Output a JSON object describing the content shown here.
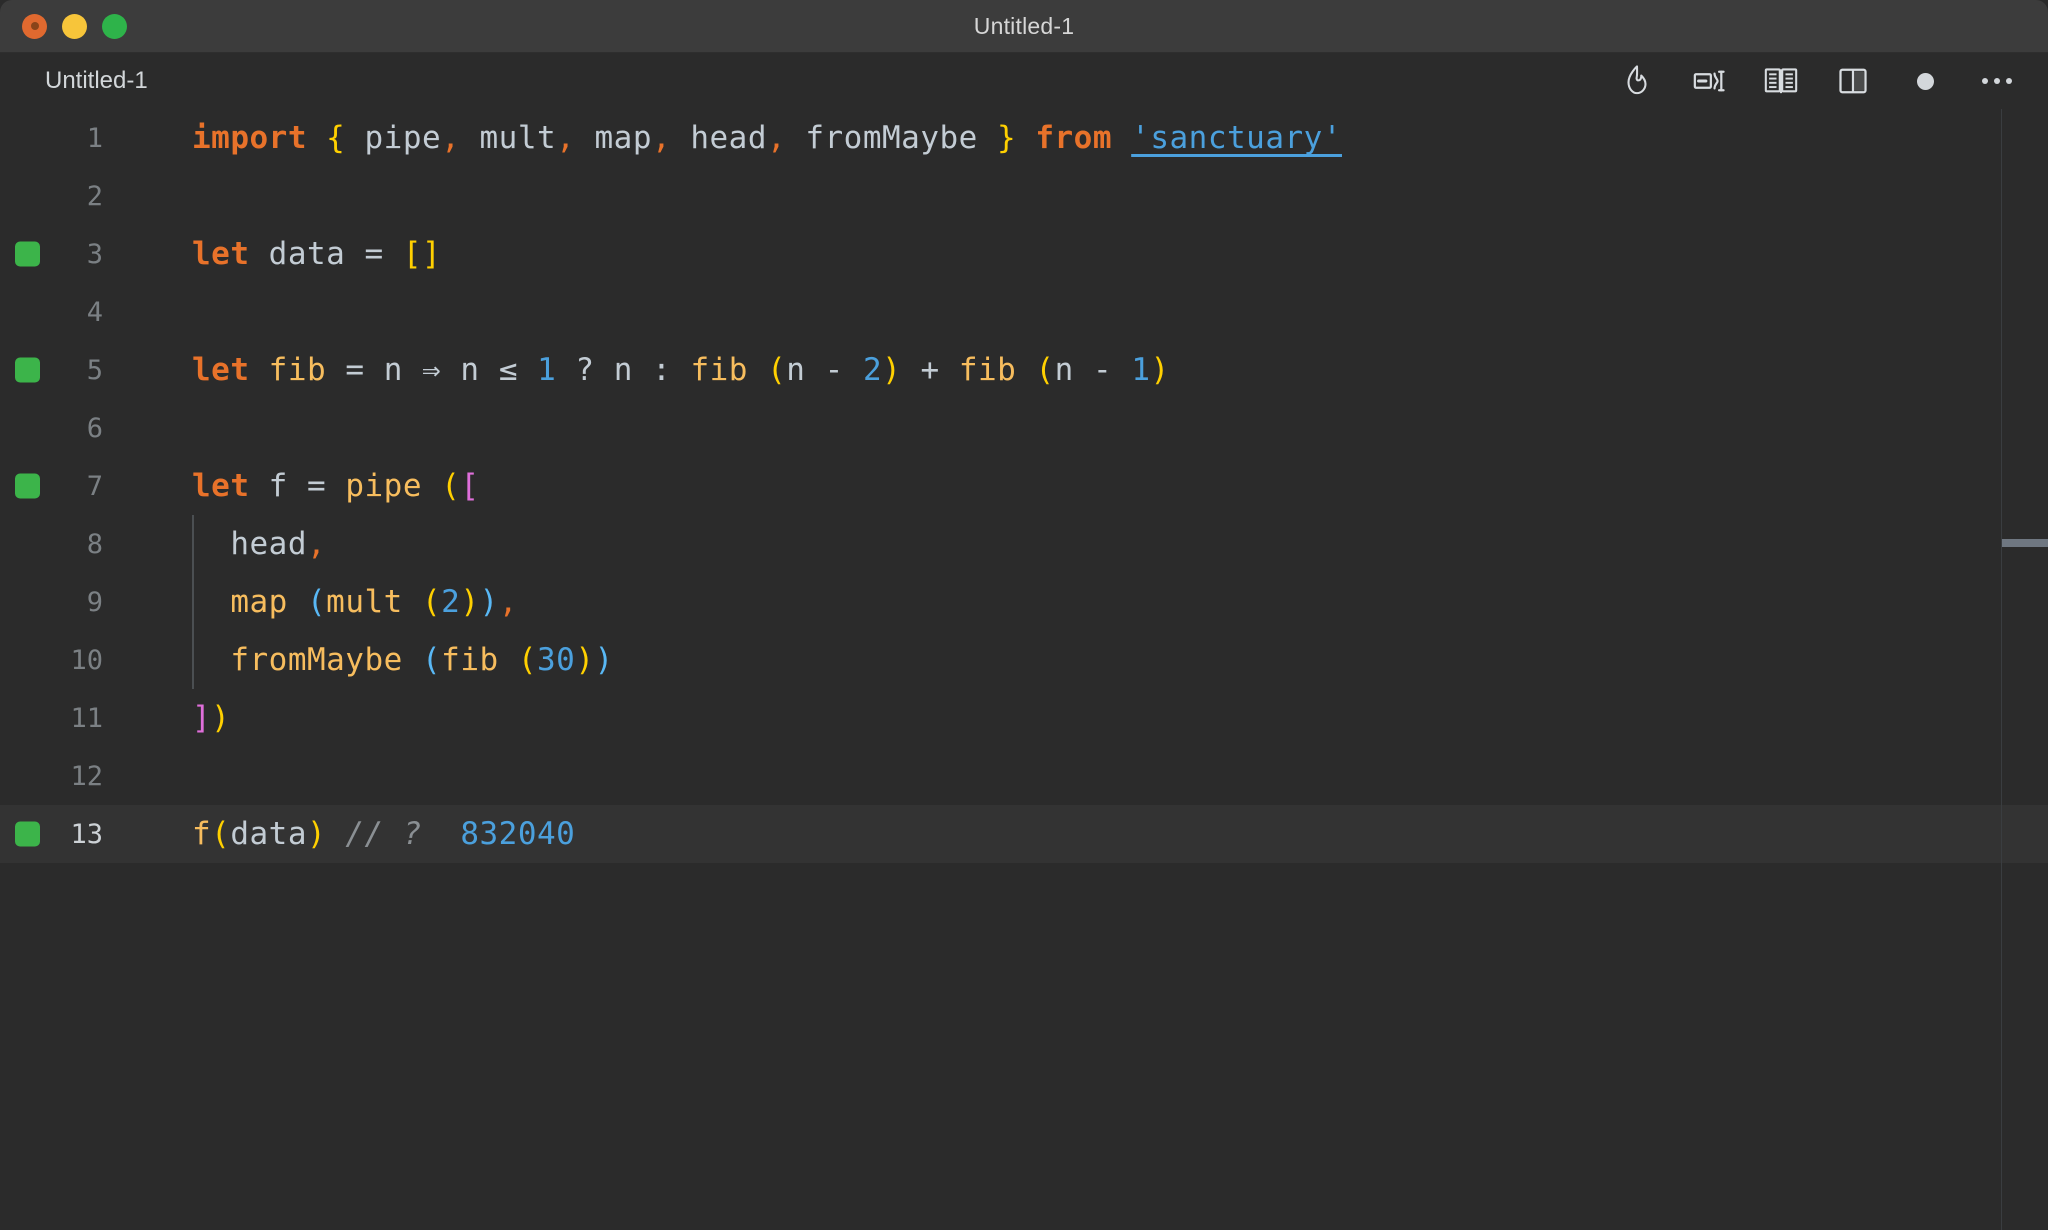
{
  "window": {
    "title": "Untitled-1",
    "traffic_lights": [
      "close-button",
      "minimize-button",
      "maximize-button"
    ]
  },
  "tabbar": {
    "tab_label": "Untitled-1",
    "toolbar_icons": [
      {
        "name": "flame-icon",
        "label": "Run Quokka"
      },
      {
        "name": "run-code-icon",
        "label": "Run Code"
      },
      {
        "name": "open-book-icon",
        "label": "Open Preview"
      },
      {
        "name": "split-editor-icon",
        "label": "Split Editor"
      },
      {
        "name": "record-dot-icon",
        "label": "Recording Indicator"
      },
      {
        "name": "more-actions-icon",
        "label": "More Actions"
      }
    ]
  },
  "editor": {
    "active_line": 13,
    "breakpoint_lines": [
      3,
      5,
      7,
      13
    ],
    "indent_guide_lines": [
      8,
      9,
      10
    ],
    "lines": [
      {
        "n": "1",
        "tokens": [
          {
            "t": "import",
            "c": "kw"
          },
          {
            "t": " ",
            "c": "op"
          },
          {
            "t": "{",
            "c": "br1"
          },
          {
            "t": " ",
            "c": "op"
          },
          {
            "t": "pipe",
            "c": "var"
          },
          {
            "t": ",",
            "c": "punc"
          },
          {
            "t": " ",
            "c": "op"
          },
          {
            "t": "mult",
            "c": "var"
          },
          {
            "t": ",",
            "c": "punc"
          },
          {
            "t": " ",
            "c": "op"
          },
          {
            "t": "map",
            "c": "var"
          },
          {
            "t": ",",
            "c": "punc"
          },
          {
            "t": " ",
            "c": "op"
          },
          {
            "t": "head",
            "c": "var"
          },
          {
            "t": ",",
            "c": "punc"
          },
          {
            "t": " ",
            "c": "op"
          },
          {
            "t": "fromMaybe",
            "c": "var"
          },
          {
            "t": " ",
            "c": "op"
          },
          {
            "t": "}",
            "c": "br1"
          },
          {
            "t": " ",
            "c": "op"
          },
          {
            "t": "from",
            "c": "kw"
          },
          {
            "t": " ",
            "c": "op"
          },
          {
            "t": "'sanctuary'",
            "c": "str"
          }
        ]
      },
      {
        "n": "2",
        "tokens": []
      },
      {
        "n": "3",
        "tokens": [
          {
            "t": "let",
            "c": "kw"
          },
          {
            "t": " ",
            "c": "op"
          },
          {
            "t": "data",
            "c": "var"
          },
          {
            "t": " ",
            "c": "op"
          },
          {
            "t": "=",
            "c": "op"
          },
          {
            "t": " ",
            "c": "op"
          },
          {
            "t": "[]",
            "c": "br1"
          }
        ]
      },
      {
        "n": "4",
        "tokens": []
      },
      {
        "n": "5",
        "tokens": [
          {
            "t": "let",
            "c": "kw"
          },
          {
            "t": " ",
            "c": "op"
          },
          {
            "t": "fib",
            "c": "fn"
          },
          {
            "t": " ",
            "c": "op"
          },
          {
            "t": "=",
            "c": "op"
          },
          {
            "t": " ",
            "c": "op"
          },
          {
            "t": "n",
            "c": "var"
          },
          {
            "t": " ",
            "c": "op"
          },
          {
            "t": "⇒",
            "c": "op"
          },
          {
            "t": " ",
            "c": "op"
          },
          {
            "t": "n",
            "c": "var"
          },
          {
            "t": " ",
            "c": "op"
          },
          {
            "t": "≤",
            "c": "op"
          },
          {
            "t": " ",
            "c": "op"
          },
          {
            "t": "1",
            "c": "num"
          },
          {
            "t": " ",
            "c": "op"
          },
          {
            "t": "?",
            "c": "op"
          },
          {
            "t": " ",
            "c": "op"
          },
          {
            "t": "n",
            "c": "var"
          },
          {
            "t": " ",
            "c": "op"
          },
          {
            "t": ":",
            "c": "op"
          },
          {
            "t": " ",
            "c": "op"
          },
          {
            "t": "fib",
            "c": "fn"
          },
          {
            "t": " ",
            "c": "op"
          },
          {
            "t": "(",
            "c": "br1"
          },
          {
            "t": "n",
            "c": "var"
          },
          {
            "t": " ",
            "c": "op"
          },
          {
            "t": "-",
            "c": "op"
          },
          {
            "t": " ",
            "c": "op"
          },
          {
            "t": "2",
            "c": "num"
          },
          {
            "t": ")",
            "c": "br1"
          },
          {
            "t": " ",
            "c": "op"
          },
          {
            "t": "+",
            "c": "op"
          },
          {
            "t": " ",
            "c": "op"
          },
          {
            "t": "fib",
            "c": "fn"
          },
          {
            "t": " ",
            "c": "op"
          },
          {
            "t": "(",
            "c": "br1"
          },
          {
            "t": "n",
            "c": "var"
          },
          {
            "t": " ",
            "c": "op"
          },
          {
            "t": "-",
            "c": "op"
          },
          {
            "t": " ",
            "c": "op"
          },
          {
            "t": "1",
            "c": "num"
          },
          {
            "t": ")",
            "c": "br1"
          }
        ]
      },
      {
        "n": "6",
        "tokens": []
      },
      {
        "n": "7",
        "tokens": [
          {
            "t": "let",
            "c": "kw"
          },
          {
            "t": " ",
            "c": "op"
          },
          {
            "t": "f",
            "c": "var"
          },
          {
            "t": " ",
            "c": "op"
          },
          {
            "t": "=",
            "c": "op"
          },
          {
            "t": " ",
            "c": "op"
          },
          {
            "t": "pipe",
            "c": "fn"
          },
          {
            "t": " ",
            "c": "op"
          },
          {
            "t": "(",
            "c": "br1"
          },
          {
            "t": "[",
            "c": "br3"
          }
        ]
      },
      {
        "n": "8",
        "tokens": [
          {
            "t": "  ",
            "c": "op"
          },
          {
            "t": "head",
            "c": "var"
          },
          {
            "t": ",",
            "c": "punc"
          }
        ]
      },
      {
        "n": "9",
        "tokens": [
          {
            "t": "  ",
            "c": "op"
          },
          {
            "t": "map",
            "c": "fn"
          },
          {
            "t": " ",
            "c": "op"
          },
          {
            "t": "(",
            "c": "br2"
          },
          {
            "t": "mult",
            "c": "fn"
          },
          {
            "t": " ",
            "c": "op"
          },
          {
            "t": "(",
            "c": "br1"
          },
          {
            "t": "2",
            "c": "num"
          },
          {
            "t": ")",
            "c": "br1"
          },
          {
            "t": ")",
            "c": "br2"
          },
          {
            "t": ",",
            "c": "punc"
          }
        ]
      },
      {
        "n": "10",
        "tokens": [
          {
            "t": "  ",
            "c": "op"
          },
          {
            "t": "fromMaybe",
            "c": "fn"
          },
          {
            "t": " ",
            "c": "op"
          },
          {
            "t": "(",
            "c": "br2"
          },
          {
            "t": "fib",
            "c": "fn"
          },
          {
            "t": " ",
            "c": "op"
          },
          {
            "t": "(",
            "c": "br1"
          },
          {
            "t": "30",
            "c": "num"
          },
          {
            "t": ")",
            "c": "br1"
          },
          {
            "t": ")",
            "c": "br2"
          }
        ]
      },
      {
        "n": "11",
        "tokens": [
          {
            "t": "]",
            "c": "br3"
          },
          {
            "t": ")",
            "c": "br1"
          }
        ]
      },
      {
        "n": "12",
        "tokens": []
      },
      {
        "n": "13",
        "tokens": [
          {
            "t": "f",
            "c": "fn"
          },
          {
            "t": "(",
            "c": "br1"
          },
          {
            "t": "data",
            "c": "var"
          },
          {
            "t": ")",
            "c": "br1"
          },
          {
            "t": " ",
            "c": "op"
          },
          {
            "t": "// ?",
            "c": "cmt"
          },
          {
            "t": "  ",
            "c": "op"
          },
          {
            "t": "832040",
            "c": "res"
          }
        ]
      }
    ]
  },
  "colors": {
    "titlebar_bg": "#3c3c3c",
    "editor_bg": "#2b2b2b",
    "active_line_bg": "#333333",
    "breakpoint_green": "#3cb44a",
    "keyword_orange": "#e8722a",
    "function_gold": "#f7bd5e",
    "number_blue": "#4ba0dd",
    "bracket_yellow": "#ffd000",
    "bracket_cyan": "#59b8f5",
    "bracket_magenta": "#e06fdb",
    "comment_gray": "#8a8f93"
  }
}
